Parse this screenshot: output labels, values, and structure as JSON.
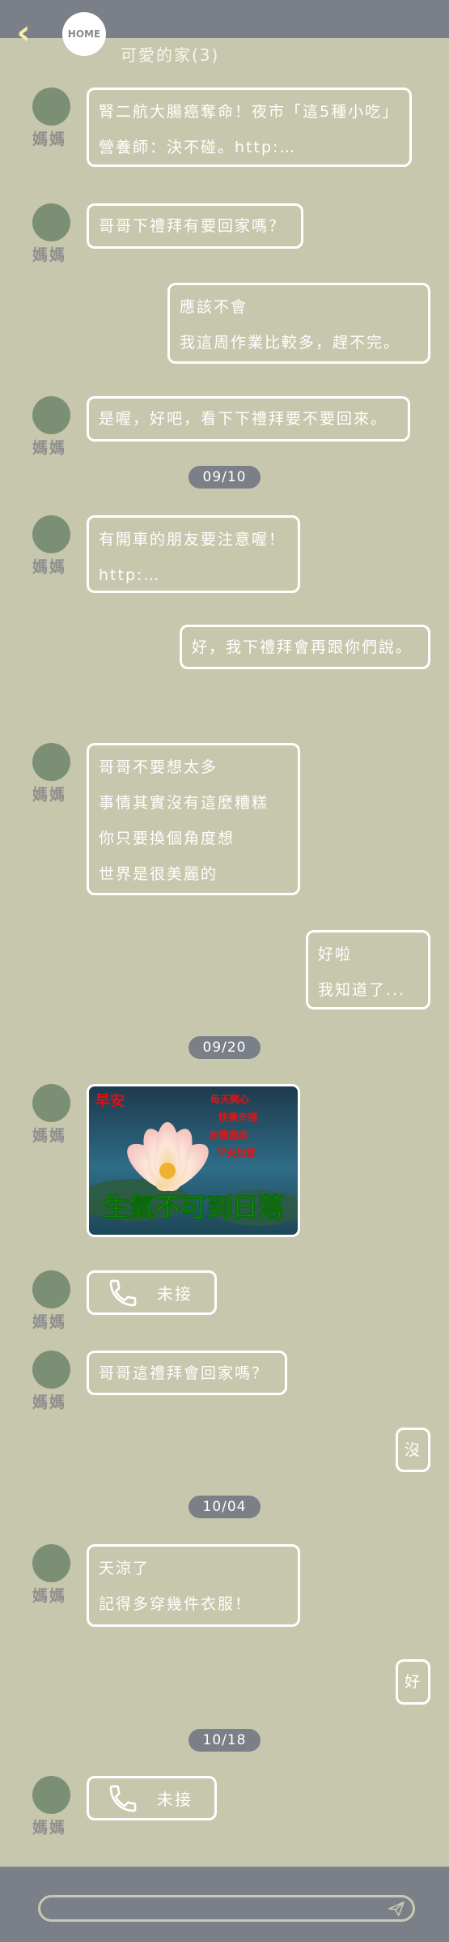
{
  "header": {
    "back_icon": "chevron-left-icon",
    "home_label": "HOME",
    "title": "可愛的家(3)"
  },
  "sender_name": "媽媽",
  "dates": [
    "09/10",
    "09/20",
    "10/04",
    "10/18"
  ],
  "messages": [
    {
      "from": "mom",
      "lines": [
        "腎二航大腸癌奪命！夜市「這5種小吃」",
        "營養師：決不碰。http:…"
      ]
    },
    {
      "from": "mom",
      "lines": [
        "哥哥下禮拜有要回家嗎？"
      ]
    },
    {
      "from": "me",
      "lines": [
        "應該不會",
        "我這周作業比較多，趕不完。"
      ]
    },
    {
      "from": "mom",
      "lines": [
        "是喔，好吧，看下下禮拜要不要回來。"
      ]
    },
    {
      "from": "mom",
      "lines": [
        "有開車的朋友要注意喔！",
        "http:…"
      ]
    },
    {
      "from": "me",
      "lines": [
        "好，我下禮拜會再跟你們說。"
      ]
    },
    {
      "from": "mom",
      "lines": [
        "哥哥不要想太多",
        "事情其實沒有這麼糟糕",
        "你只要換個角度想",
        "世界是很美麗的"
      ]
    },
    {
      "from": "me",
      "lines": [
        "好啦",
        "我知道了..."
      ]
    },
    {
      "from": "mom",
      "type": "image",
      "image": {
        "top_left": "早安",
        "lines": [
          "每天開心",
          "快樂幸福",
          "身體健康",
          "平安如意"
        ],
        "headline": "生氣不可到日落"
      }
    },
    {
      "from": "mom",
      "type": "call",
      "icon": "phone-icon",
      "label": "未接"
    },
    {
      "from": "mom",
      "lines": [
        "哥哥這禮拜會回家嗎？"
      ]
    },
    {
      "from": "me",
      "lines": [
        "沒"
      ]
    },
    {
      "from": "mom",
      "lines": [
        "天涼了",
        "記得多穿幾件衣服！"
      ]
    },
    {
      "from": "me",
      "lines": [
        "好"
      ]
    },
    {
      "from": "mom",
      "type": "call",
      "icon": "phone-icon",
      "label": "未接"
    }
  ],
  "composer": {
    "placeholder": "",
    "send_icon": "send-icon"
  },
  "colors": {
    "background": "#c7c7ad",
    "bars": "#7a7f88",
    "avatar": "#7b8f75",
    "back_arrow": "#f4f0a6"
  }
}
